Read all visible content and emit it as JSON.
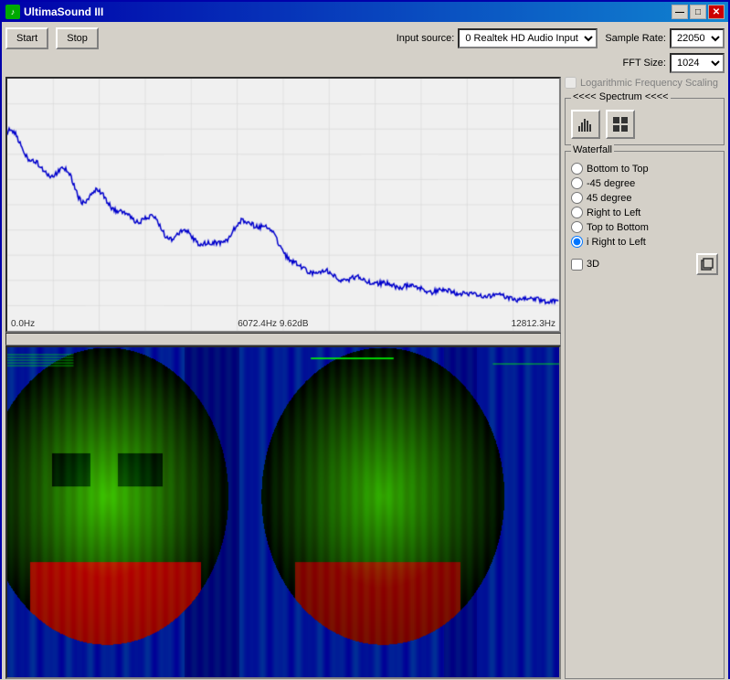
{
  "window": {
    "title": "UltimaSound III",
    "icon": "♪"
  },
  "titlebar_buttons": {
    "minimize": "—",
    "maximize": "□",
    "close": "✕"
  },
  "toolbar": {
    "start_label": "Start",
    "stop_label": "Stop",
    "input_source_label": "Input source:",
    "input_source_value": "0 Realtek HD Audio Input",
    "sample_rate_label": "Sample Rate:",
    "sample_rate_value": "22050",
    "fft_size_label": "FFT Size:",
    "fft_size_value": "1024"
  },
  "spectrum": {
    "log_freq_label": "Logarithmic Frequency Scaling",
    "group_title": "<<<< Spectrum <<<<",
    "freq_left": "0.0Hz",
    "freq_center": "6072.4Hz 9.62dB",
    "freq_right": "12812.3Hz"
  },
  "waterfall": {
    "group_title": "Waterfall",
    "options": [
      {
        "label": "Bottom to Top",
        "value": "bottom_to_top",
        "selected": false
      },
      {
        "label": "-45 degree",
        "value": "minus45",
        "selected": false
      },
      {
        "label": "45 degree",
        "value": "plus45",
        "selected": false
      },
      {
        "label": "Right to Left",
        "value": "right_to_left",
        "selected": false
      },
      {
        "label": "Top to Bottom",
        "value": "top_to_bottom",
        "selected": false
      },
      {
        "label": "i Right to Left",
        "value": "i_right_to_left",
        "selected": true
      }
    ],
    "three_d_label": "3D"
  }
}
